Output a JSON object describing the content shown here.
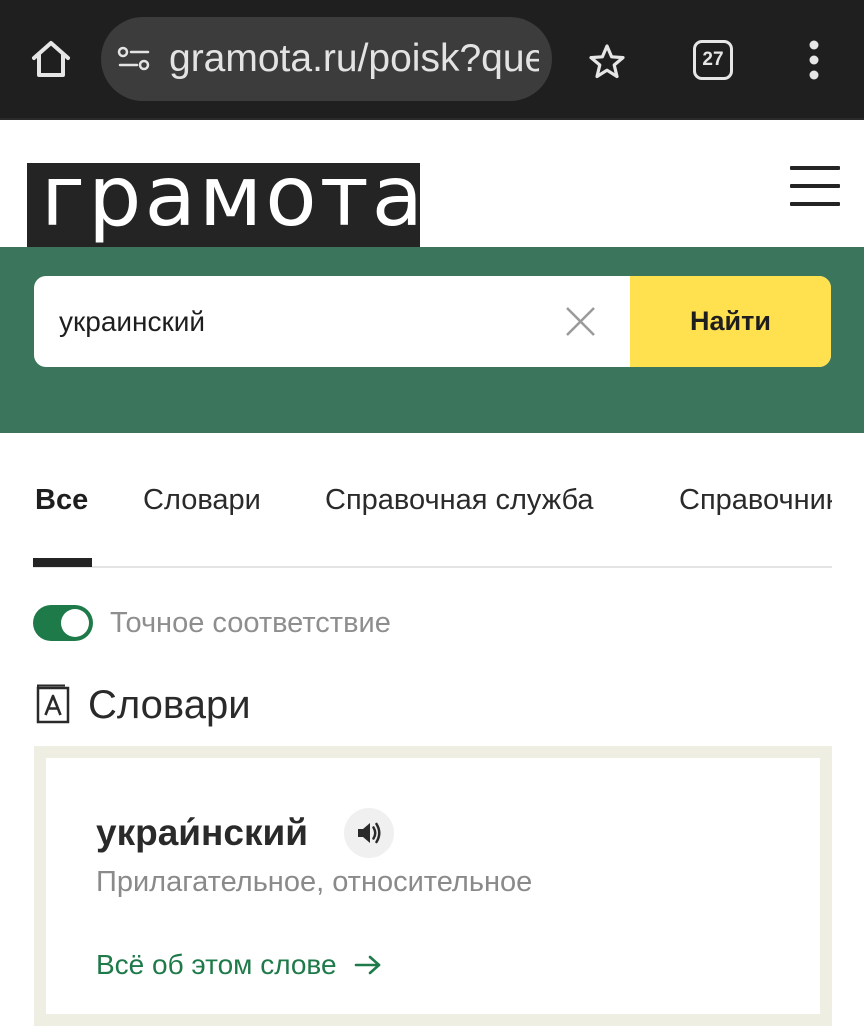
{
  "browser": {
    "url": "gramota.ru/poisk?query=украинский",
    "tab_count": "27"
  },
  "site": {
    "logo_text": "грамота"
  },
  "search": {
    "value": "украинский",
    "button_label": "Найти"
  },
  "tabs": [
    {
      "label": "Все",
      "active": true
    },
    {
      "label": "Словари",
      "active": false
    },
    {
      "label": "Справочная служба",
      "active": false
    },
    {
      "label": "Справочник",
      "active": false
    }
  ],
  "filter": {
    "exact_match_label": "Точное соответствие",
    "exact_match_on": true
  },
  "section": {
    "title": "Словари"
  },
  "result": {
    "word": "украи́нский",
    "part_of_speech": "Прилагательное, относительное",
    "more_link": "Всё об этом слове"
  },
  "colors": {
    "band": "#3b755c",
    "search_button": "#ffe14f",
    "accent_green": "#1f7a4a",
    "logo_bg": "#242424",
    "card_border": "#eeeee3"
  }
}
